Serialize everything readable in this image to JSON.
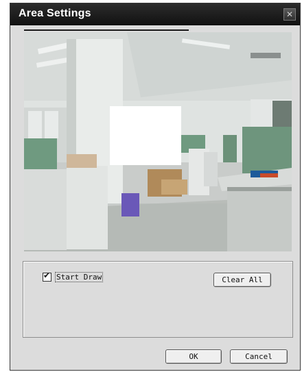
{
  "window": {
    "title": "Area Settings",
    "close_glyph": "✕"
  },
  "preview": {
    "image_icon": "camera-feed",
    "has_mask_region": true
  },
  "drawing": {
    "start_draw_label": "Start Draw",
    "start_draw_checked": true,
    "clear_all_label": "Clear All"
  },
  "footer": {
    "ok_label": "OK",
    "cancel_label": "Cancel"
  }
}
